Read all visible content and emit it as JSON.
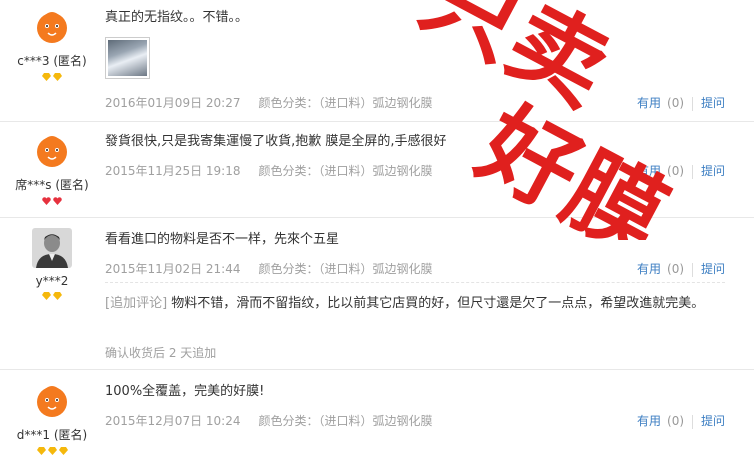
{
  "reviews": [
    {
      "user": "c***3 (匿名)",
      "text": "真正的无指纹。。不错。。",
      "date": "2016年01月09日 20:27",
      "sku": "颜色分类：（进口料）弧边钢化膜",
      "useful_label": "有用",
      "useful_count": "(0)",
      "ask_label": "提问"
    },
    {
      "user": "席***s (匿名)",
      "text": "發貨很快,只是我寄集運慢了收貨,抱歉 膜是全屏的,手感很好",
      "date": "2015年11月25日 19:18",
      "sku": "颜色分类：（进口料）弧边钢化膜",
      "useful_label": "有用",
      "useful_count": "(0)",
      "ask_label": "提问"
    },
    {
      "user": "y***2",
      "text": "看看進口的物料是否不一样，先來个五星",
      "date": "2015年11月02日 21:44",
      "sku": "颜色分类：（进口料）弧边钢化膜",
      "useful_label": "有用",
      "useful_count": "(0)",
      "ask_label": "提问",
      "append_tag": "[追加评论]",
      "append_text": "物料不错，滑而不留指纹，比以前其它店買的好，但尺寸還是欠了一点点，希望改進就完美。",
      "append_note": "确认收货后 2 天追加"
    },
    {
      "user": "d***1 (匿名)",
      "text": "100%全覆盖，完美的好膜!",
      "date": "2015年12月07日 10:24",
      "sku": "颜色分类：（进口料）弧边钢化膜",
      "useful_label": "有用",
      "useful_count": "(0)",
      "ask_label": "提问"
    }
  ],
  "watermark": {
    "line1": "只卖",
    "line2": "好膜"
  },
  "colors": {
    "link": "#3c7ec2",
    "watermark": "#e0201e",
    "muted": "#a0a0a0"
  }
}
